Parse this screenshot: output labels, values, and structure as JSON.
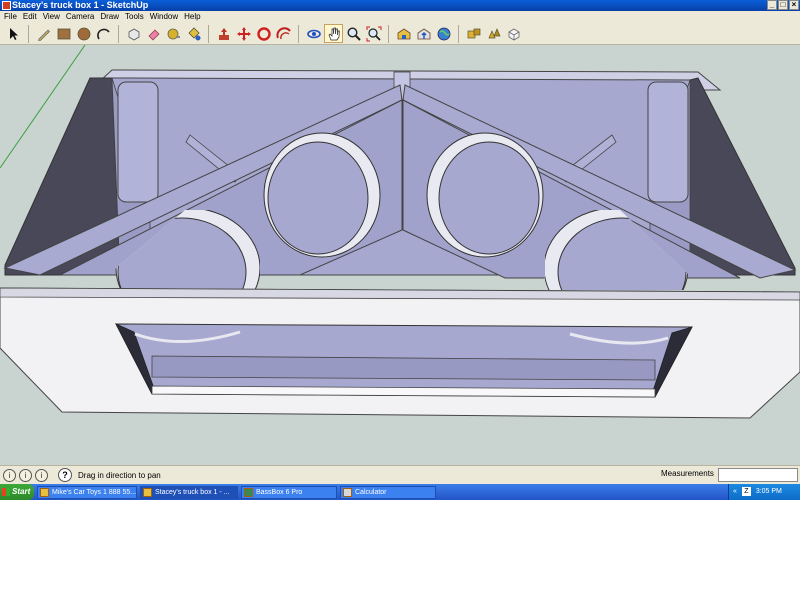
{
  "window": {
    "title": "Stacey's truck box 1 - SketchUp",
    "controls": [
      "_",
      "□",
      "×"
    ]
  },
  "menu": [
    "File",
    "Edit",
    "View",
    "Camera",
    "Draw",
    "Tools",
    "Window",
    "Help"
  ],
  "toolbar": {
    "tools": [
      {
        "name": "select-tool",
        "icon": "arrow-icon"
      },
      {
        "name": "line-tool",
        "icon": "pencil-icon"
      },
      {
        "name": "rectangle-tool",
        "icon": "rectangle-icon"
      },
      {
        "name": "circle-tool",
        "icon": "circle-icon"
      },
      {
        "name": "arc-tool",
        "icon": "arc-icon"
      },
      {
        "name": "make-component-tool",
        "icon": "component-icon"
      },
      {
        "name": "eraser-tool",
        "icon": "eraser-icon"
      },
      {
        "name": "tape-measure-tool",
        "icon": "tape-icon"
      },
      {
        "name": "paint-bucket-tool",
        "icon": "paint-bucket-icon"
      },
      {
        "name": "push-pull-tool",
        "icon": "push-pull-icon"
      },
      {
        "name": "move-tool",
        "icon": "move-icon"
      },
      {
        "name": "rotate-tool",
        "icon": "rotate-icon"
      },
      {
        "name": "offset-tool",
        "icon": "offset-icon"
      },
      {
        "name": "orbit-tool",
        "icon": "orbit-icon"
      },
      {
        "name": "pan-tool",
        "icon": "hand-icon"
      },
      {
        "name": "zoom-tool",
        "icon": "magnifier-icon"
      },
      {
        "name": "zoom-extents-tool",
        "icon": "zoom-extents-icon"
      },
      {
        "name": "get-models-tool",
        "icon": "warehouse-icon"
      },
      {
        "name": "share-model-tool",
        "icon": "share-icon"
      },
      {
        "name": "google-earth-tool",
        "icon": "earth-icon"
      },
      {
        "name": "components-tool",
        "icon": "components-icon"
      },
      {
        "name": "components-extra-tool",
        "icon": "components2-icon"
      },
      {
        "name": "3d-warehouse-tool",
        "icon": "box-icon"
      }
    ],
    "active_tool": "pan-tool"
  },
  "statusbar": {
    "hint": "Drag in direction to pan",
    "measurements_label": "Measurements",
    "measurements_value": ""
  },
  "taskbar": {
    "start_label": "Start",
    "tasks": [
      {
        "label": "Mike's Car Toys 1 888 55...",
        "active": false
      },
      {
        "label": "Stacey's truck box 1 - ...",
        "active": true
      },
      {
        "label": "BassBox 6 Pro",
        "active": false
      },
      {
        "label": "Calculator",
        "active": false
      }
    ],
    "tray_arrows": "«",
    "tray_icon": "Z",
    "clock": "3:05 PM"
  },
  "colors": {
    "viewport_bg": "#c9d4d1",
    "model_face": "#a7a8d0",
    "model_dark": "#484858",
    "model_light": "#f2f2f4"
  }
}
